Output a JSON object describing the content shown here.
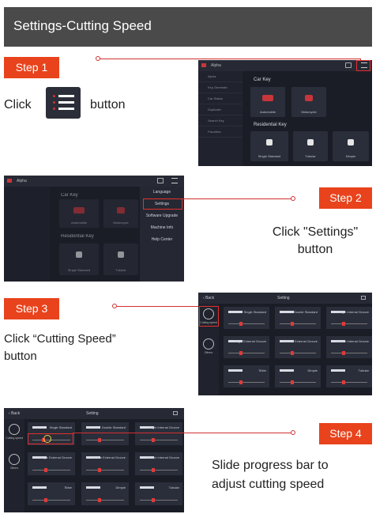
{
  "header": {
    "title": "Settings-Cutting Speed"
  },
  "steps": [
    {
      "badge": "Step 1",
      "text_before": "Click",
      "text_after": "button"
    },
    {
      "badge": "Step 2",
      "line1": "Click \"Settings\"",
      "line2": "button"
    },
    {
      "badge": "Step 3",
      "line1": "Click “Cutting Speed”",
      "line2": "button"
    },
    {
      "badge": "Step 4",
      "line1": "Slide progress bar to",
      "line2": "adjust cutting speed"
    }
  ],
  "shot1": {
    "title": "Alpha",
    "sidebar": [
      "Alpha",
      "Key Generate",
      "Car Status",
      "Duplicate",
      "Search Key",
      "Favorites"
    ],
    "car_key": "Car Key",
    "car_tiles": [
      "Automobile",
      "Motorcycle"
    ],
    "res_key": "Residential Key",
    "res_tiles": [
      "Single Standard",
      "Tubular",
      "Dimple"
    ]
  },
  "shot2": {
    "title": "Alpha",
    "car_key": "Car Key",
    "res_key": "Residential Key",
    "tiles": [
      "Automobile",
      "Motorcycle",
      "Single Standard",
      "Tubular"
    ],
    "menu": [
      "Language",
      "Settings",
      "Software Upgrade",
      "Machine Info",
      "Help Center"
    ]
  },
  "shot3": {
    "back": "Back",
    "title": "Setting",
    "nav": [
      "Cutting speed",
      "Others"
    ],
    "rows": [
      "Single Standard",
      "Double Standard",
      "Single Internal Groove",
      "Single External Groove",
      "Double External Groove",
      "Double Internal Groove",
      "Tibbe",
      "Dimple",
      "Tubular"
    ],
    "knobs": [
      0.35,
      0.35,
      0.35,
      0.35,
      0.35,
      0.35,
      0.35,
      0.35,
      0.35
    ]
  },
  "shot4": {
    "back": "Back",
    "title": "Setting",
    "nav": [
      "Cutting speed",
      "Others"
    ],
    "rows": [
      "Single Standard",
      "Double Standard",
      "Single Internal Groove",
      "Single External Groove",
      "Double External Groove",
      "Double Internal Groove",
      "Tibbe",
      "Dimple",
      "Tubular"
    ],
    "knobs": [
      0.3,
      0.35,
      0.35,
      0.35,
      0.35,
      0.35,
      0.35,
      0.35,
      0.35
    ]
  }
}
